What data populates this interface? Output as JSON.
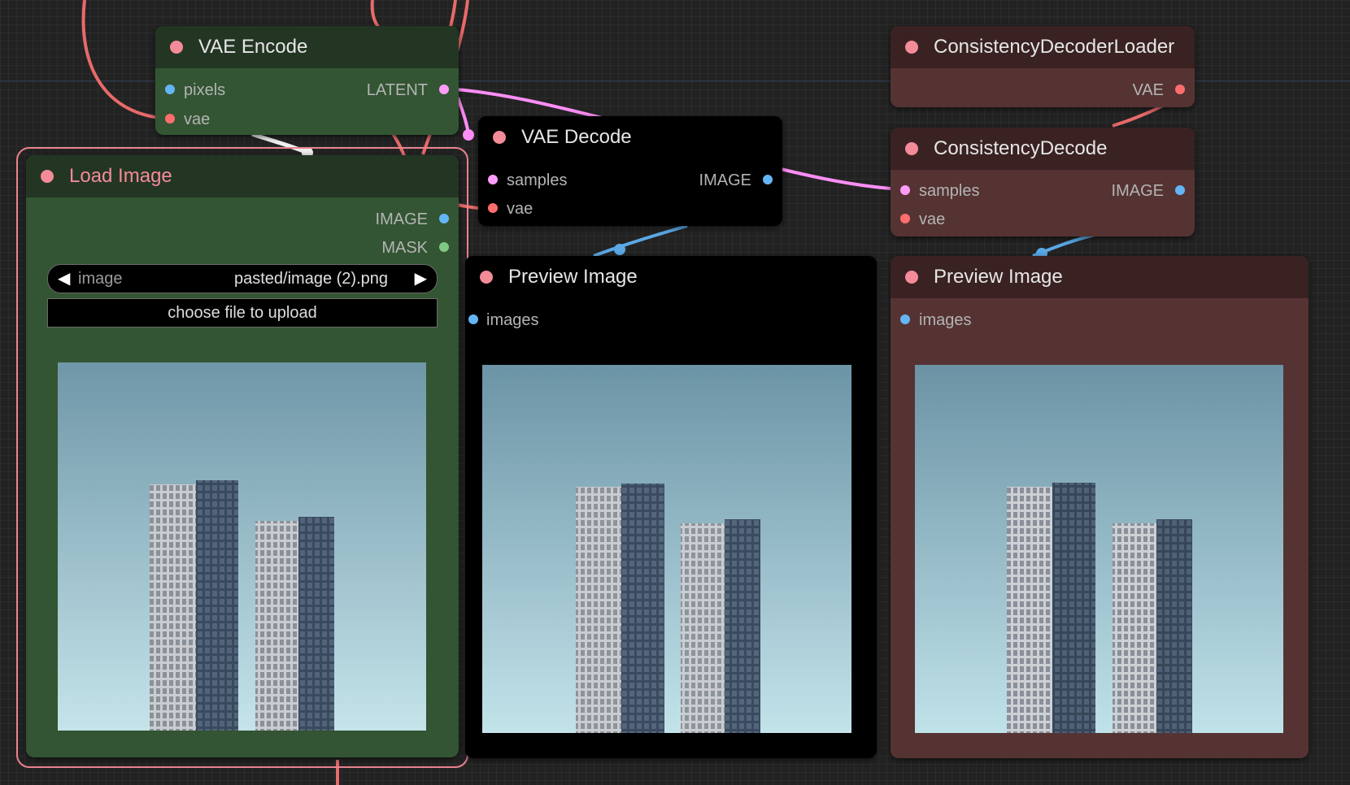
{
  "colors": {
    "canvas": "#222222",
    "slot_image": "#64b5f6",
    "slot_vae": "#ff6e6e",
    "slot_latent": "#ff9cf9",
    "slot_mask": "#81c784",
    "node_dot": "#f48b98",
    "green_node": "#335533",
    "brown_node": "#553333"
  },
  "nodes": {
    "vae_encode": {
      "title": "VAE Encode",
      "inputs": [
        "pixels",
        "vae"
      ],
      "outputs": [
        "LATENT"
      ]
    },
    "load_image": {
      "title": "Load Image",
      "outputs": [
        "IMAGE",
        "MASK"
      ],
      "image_widget": {
        "label": "image",
        "value": "pasted/image (2).png",
        "left_arrow": "◀",
        "right_arrow": "▶"
      },
      "upload_button": "choose file to upload"
    },
    "vae_decode": {
      "title": "VAE Decode",
      "inputs": [
        "samples",
        "vae"
      ],
      "outputs": [
        "IMAGE"
      ]
    },
    "preview_1": {
      "title": "Preview Image",
      "inputs": [
        "images"
      ]
    },
    "consistency_loader": {
      "title": "ConsistencyDecoderLoader",
      "outputs": [
        "VAE"
      ]
    },
    "consistency_decode": {
      "title": "ConsistencyDecode",
      "inputs": [
        "samples",
        "vae"
      ],
      "outputs": [
        "IMAGE"
      ]
    },
    "preview_2": {
      "title": "Preview Image",
      "inputs": [
        "images"
      ]
    }
  }
}
